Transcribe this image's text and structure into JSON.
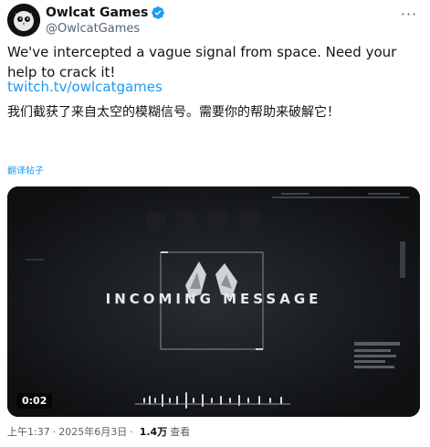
{
  "account": {
    "display_name": "Owlcat Games",
    "handle": "@OwlcatGames",
    "verified_color": "#1d9bf0"
  },
  "menu": {
    "more_icon": "ellipsis-icon",
    "label": "···"
  },
  "tweet": {
    "text": "We've intercepted a vague signal from space. Need your help to crack it!",
    "link": "twitch.tv/owlcatgames",
    "chinese_text": "我们截获了来自太空的模糊信号。需要你的帮助来破解它！",
    "translate_label": "翻译帖子"
  },
  "video": {
    "overlay_text": "INCOMING MESSAGE",
    "duration": "0:02"
  },
  "meta": {
    "time": "上午1:37",
    "date": "2025年6月3日",
    "views_count": "1.4万",
    "views_label": "查看",
    "separator": "·"
  },
  "colors": {
    "accent": "#1d9bf0",
    "text": "#0f1419",
    "secondary": "#536471"
  }
}
